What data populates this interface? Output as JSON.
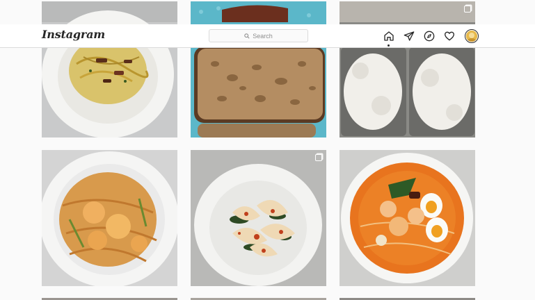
{
  "app": {
    "logo": "Instagram"
  },
  "search": {
    "placeholder": "Search"
  },
  "nav_icons": [
    "home-icon",
    "direct-message-icon",
    "explore-compass-icon",
    "activity-heart-icon",
    "profile-avatar"
  ],
  "colors": {
    "background": "#fafafa",
    "nav_background": "#ffffff",
    "border": "#dbdbdb",
    "icon": "#262626"
  },
  "posts": [
    {
      "subject": "spaghetti with bacon on white plate",
      "multi_image": false
    },
    {
      "subject": "sliced sourdough bread on teal cloth",
      "multi_image": false
    },
    {
      "subject": "dough rising in loaf pans",
      "multi_image": true
    },
    {
      "subject": "stir-fried noodles with prawns",
      "multi_image": false
    },
    {
      "subject": "wontons with chili oil and greens",
      "multi_image": true
    },
    {
      "subject": "laksa noodle soup with prawns and eggs",
      "multi_image": false
    }
  ]
}
